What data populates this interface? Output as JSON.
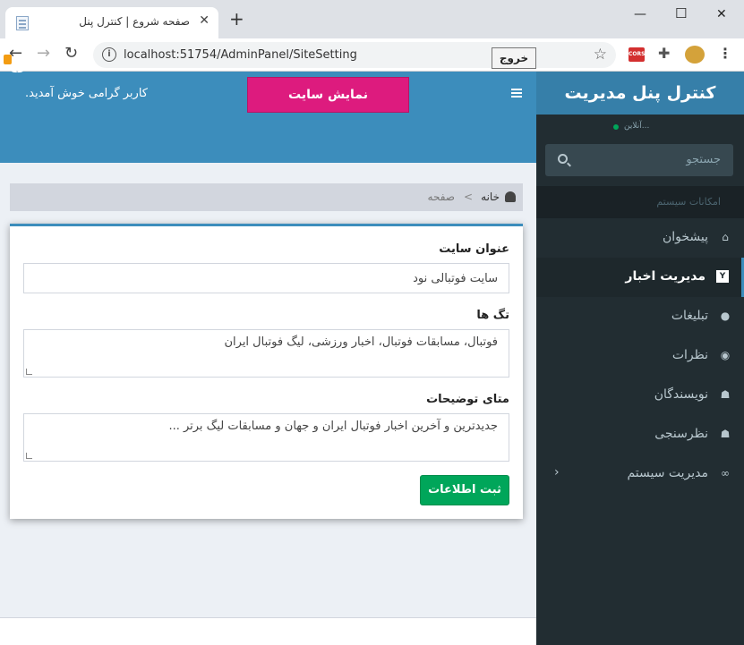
{
  "browser": {
    "tab_title": "صفحه شروع | کنترل پنل",
    "url": "localhost:51754/AdminPanel/SiteSetting",
    "ext_cors": "CORS"
  },
  "sidebar": {
    "brand": "کنترل پنل مدیریت",
    "user_status": "...آنلاین",
    "search_placeholder": "جستجو",
    "menu_header": "امکانات سیستم",
    "items": [
      {
        "label": "پیشخوان",
        "icon": "home-icon",
        "glyph": "⌂",
        "active": false
      },
      {
        "label": "مدیریت اخبار",
        "icon": "news-icon",
        "glyph": "Y",
        "active": true
      },
      {
        "label": "تبلیغات",
        "icon": "ads-icon",
        "glyph": "●",
        "active": false
      },
      {
        "label": "نظرات",
        "icon": "comment-icon",
        "glyph": "◉",
        "active": false
      },
      {
        "label": "نویسندگان",
        "icon": "user-icon",
        "glyph": "☗",
        "active": false
      },
      {
        "label": "نظرسنجی",
        "icon": "users-icon",
        "glyph": "☗",
        "active": false
      },
      {
        "label": "مدیریت سیستم",
        "icon": "link-icon",
        "glyph": "∞",
        "active": false
      }
    ]
  },
  "header": {
    "show_site": "نمایش سایت",
    "welcome": "کاربر گرامی خوش آمدید.",
    "logout": "خروج"
  },
  "breadcrumb": {
    "home": "خانه",
    "separator": ">",
    "page": "صفحه"
  },
  "form": {
    "title_label": "عنوان سایت",
    "title_value": "سایت فوتبالی نود",
    "tags_label": "تگ ها",
    "tags_value": "فوتبال، مسابقات فوتبال، اخبار ورزشی، لیگ فوتبال ایران",
    "meta_label": "متای توضیحات",
    "meta_value": "جدیدترین و آخرین اخبار فوتبال ایران و جهان و مسابقات لیگ برتر ...",
    "submit": "ثبت اطلاعات"
  },
  "colors": {
    "header": "#3c8dbc",
    "sidebar": "#222d32",
    "brand": "#367fa9",
    "show_site": "#dd1b7e",
    "submit": "#00a65a"
  }
}
